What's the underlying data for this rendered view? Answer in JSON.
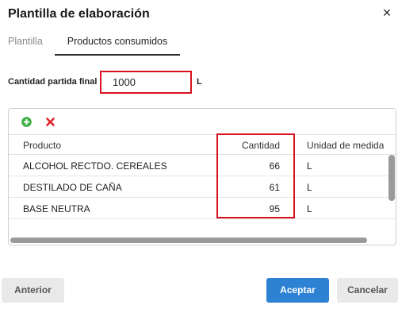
{
  "dialog": {
    "title": "Plantilla de elaboración",
    "close_icon": "×"
  },
  "tabs": [
    {
      "label": "Plantilla",
      "active": false
    },
    {
      "label": "Productos consumidos",
      "active": true
    }
  ],
  "form": {
    "quantity_label": "Cantidad partida final",
    "quantity_value": "1000",
    "unit": "L"
  },
  "toolbar": {
    "add_icon": "plus-circle-icon",
    "delete_icon": "x-icon",
    "colors": {
      "add": "#3cb043",
      "delete": "#e0262c"
    }
  },
  "table": {
    "columns": [
      "Producto",
      "Cantidad",
      "Unidad de medida"
    ],
    "rows": [
      {
        "producto": "ALCOHOL RECTDO. CEREALES",
        "cantidad": "66",
        "unidad": "L"
      },
      {
        "producto": "DESTILADO DE CAÑA",
        "cantidad": "61",
        "unidad": "L"
      },
      {
        "producto": "BASE NEUTRA",
        "cantidad": "95",
        "unidad": "L"
      }
    ]
  },
  "buttons": {
    "previous": "Anterior",
    "accept": "Aceptar",
    "cancel": "Cancelar"
  },
  "colors": {
    "accent": "#2e82d3",
    "highlight": "#d9121b"
  }
}
